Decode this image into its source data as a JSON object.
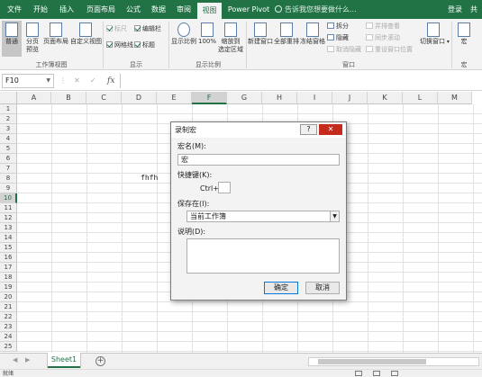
{
  "tabs": [
    "文件",
    "开始",
    "插入",
    "页面布局",
    "公式",
    "数据",
    "审阅",
    "视图",
    "Power Pivot"
  ],
  "active_tab": "视图",
  "tell_me": "告诉我您想要做什么...",
  "login": "登录",
  "share": "共",
  "ribbon": {
    "workbook_views": {
      "normal": "普通",
      "page_break_1": "分页",
      "page_break_2": "预览",
      "page_layout": "页面布局",
      "custom_views": "自定义视图",
      "group_label": "工作簿视图"
    },
    "show": {
      "ruler": "标尺",
      "formula_bar": "编辑栏",
      "gridlines": "网格线",
      "headings": "标题",
      "group_label": "显示"
    },
    "zoom": {
      "zoom": "显示比例",
      "hundred": "100%",
      "to_selection_1": "缩放到",
      "to_selection_2": "选定区域",
      "group_label": "显示比例"
    },
    "window": {
      "new_window": "新建窗口",
      "arrange_all": "全部重排",
      "freeze_panes": "冻结窗格",
      "split": "拆分",
      "hide": "隐藏",
      "unhide": "取消隐藏",
      "side_by_side": "并排查看",
      "sync_scroll": "同步滚动",
      "reset_position": "重设窗口位置",
      "switch_windows": "切换窗口",
      "group_label": "窗口"
    },
    "macros": {
      "label": "宏",
      "group_label": "宏"
    }
  },
  "formula_bar": {
    "name_box": "F10",
    "fx": "fx",
    "cancel": "✕",
    "enter": "✓",
    "value": ""
  },
  "columns": [
    "A",
    "B",
    "C",
    "D",
    "E",
    "F",
    "G",
    "H",
    "I",
    "J",
    "K",
    "L",
    "M"
  ],
  "selected_column": "F",
  "rows": [
    "1",
    "2",
    "3",
    "4",
    "5",
    "6",
    "7",
    "8",
    "9",
    "10",
    "11",
    "12",
    "13",
    "14",
    "15",
    "16",
    "17",
    "18",
    "19",
    "20",
    "21",
    "22",
    "23",
    "24",
    "25"
  ],
  "selected_row": "10",
  "cell_text": "fhfh",
  "sheet_tab": "Sheet1",
  "status": "就绪",
  "dialog": {
    "title": "录制宏",
    "help": "?",
    "close": "✕",
    "macro_name_label": "宏名(M):",
    "macro_name_value": "宏",
    "shortcut_label": "快捷键(K):",
    "ctrl_label": "Ctrl+",
    "store_in_label": "保存在(I):",
    "store_in_value": "当前工作簿",
    "description_label": "说明(D):",
    "ok": "确定",
    "cancel": "取消"
  }
}
